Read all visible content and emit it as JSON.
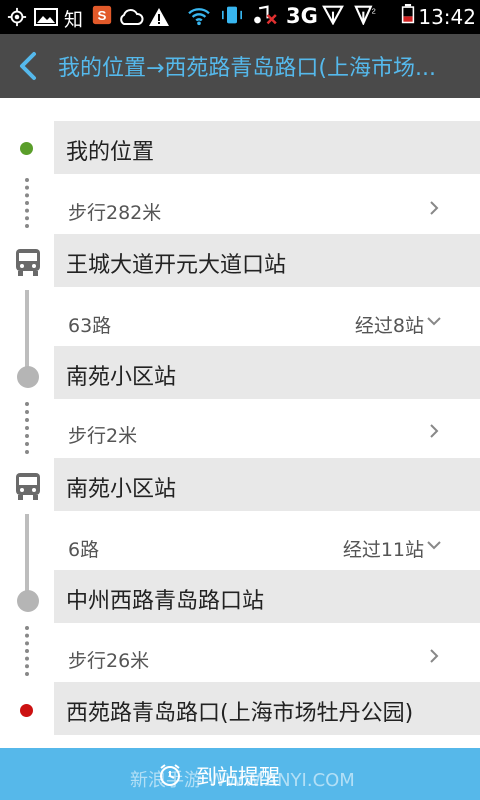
{
  "status_bar": {
    "time": "13:42",
    "network": "3G",
    "app_label": "知",
    "icons": [
      "gps-icon",
      "image-icon",
      "zhihu-icon",
      "sogou-icon",
      "cloud-icon",
      "warning-icon",
      "wifi-icon",
      "vibrate-icon",
      "music-off-icon",
      "signal-icon",
      "signal2-icon",
      "battery-icon"
    ]
  },
  "header": {
    "title": "我的位置→西苑路青岛路口(上海市场..."
  },
  "route": {
    "stops": [
      {
        "name": "我的位置",
        "kind": "start"
      },
      {
        "name": "王城大道开元大道口站",
        "kind": "bus"
      },
      {
        "name": "南苑小区站",
        "kind": "alight"
      },
      {
        "name": "南苑小区站",
        "kind": "bus"
      },
      {
        "name": "中州西路青岛路口站",
        "kind": "alight"
      },
      {
        "name": "西苑路青岛路口(上海市场牡丹公园)",
        "kind": "end"
      }
    ],
    "segments": [
      {
        "label": "步行282米",
        "right": "",
        "chevron": "right"
      },
      {
        "label": "63路",
        "right": "经过8站",
        "chevron": "down"
      },
      {
        "label": "步行2米",
        "right": "",
        "chevron": "right"
      },
      {
        "label": "6路",
        "right": "经过11站",
        "chevron": "down"
      },
      {
        "label": "步行26米",
        "right": "",
        "chevron": "right"
      }
    ]
  },
  "bottom": {
    "button_label": "到站提醒",
    "watermark": "新浪手游  WWW.ANYI.COM"
  },
  "colors": {
    "accent": "#56b8ea",
    "header_bg": "#4a4a4a",
    "title": "#55b9ec",
    "start_dot": "#5a9e2a",
    "end_dot": "#cc1111"
  }
}
